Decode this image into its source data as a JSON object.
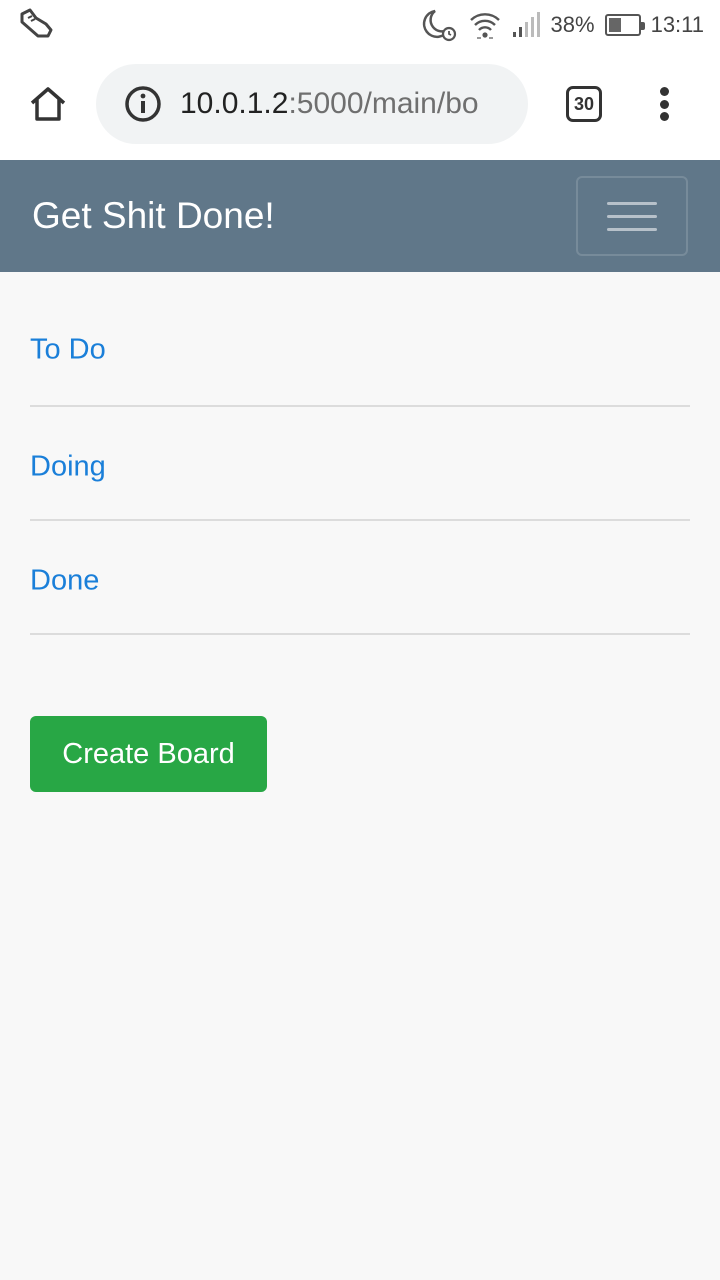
{
  "status_bar": {
    "battery_percent": "38%",
    "battery_level": 0.38,
    "time": "13:11"
  },
  "browser": {
    "url_host": "10.0.1.2",
    "url_path": ":5000/main/bo",
    "tab_count": "30"
  },
  "navbar": {
    "brand": "Get Shit Done!"
  },
  "boards": [
    {
      "label": "To Do"
    },
    {
      "label": "Doing"
    },
    {
      "label": "Done"
    }
  ],
  "actions": {
    "create_board_label": "Create Board"
  },
  "colors": {
    "navbar_bg": "#607789",
    "link": "#1a7fd9",
    "create_button": "#28a745",
    "page_bg": "#f8f8f8"
  },
  "icons": {
    "status_left": "sneaker-icon",
    "dnd": "moon-icon",
    "alarm": "alarm-clock-icon",
    "wifi": "wifi-icon",
    "signal": "signal-icon",
    "battery": "battery-icon",
    "home": "home-icon",
    "site_info": "info-icon",
    "overflow": "more-vert-icon",
    "nav_toggle": "hamburger-icon"
  }
}
